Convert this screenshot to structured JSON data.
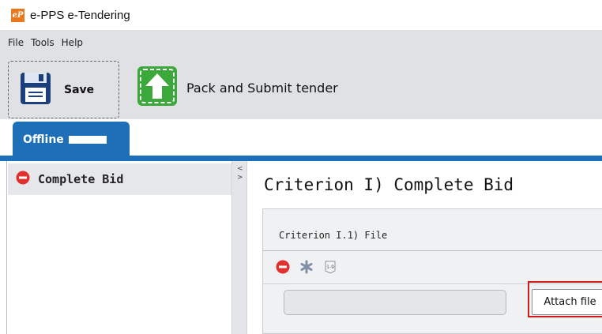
{
  "window": {
    "app_icon_text": "eP",
    "title": "e-PPS e-Tendering"
  },
  "menubar": {
    "items": [
      "File",
      "Tools",
      "Help"
    ]
  },
  "toolbar": {
    "save_label": "Save",
    "pack_label": "Pack and Submit tender"
  },
  "tabs": {
    "offline_label": "Offline"
  },
  "tree": {
    "items": [
      {
        "label": "Complete Bid",
        "status_icon": "error-circle-icon"
      }
    ]
  },
  "splitter": {
    "arrows": [
      "<",
      ">"
    ]
  },
  "criterion": {
    "title": "Criterion I) Complete Bid",
    "sub_title": "Criterion I.1) File",
    "file_value": "",
    "attach_label": "Attach file"
  },
  "colors": {
    "accent_blue": "#1d6fb8",
    "status_red": "#e0302f",
    "action_green": "#3aa83a",
    "highlight_red": "#d11a1a",
    "app_icon_orange": "#e8771d"
  }
}
